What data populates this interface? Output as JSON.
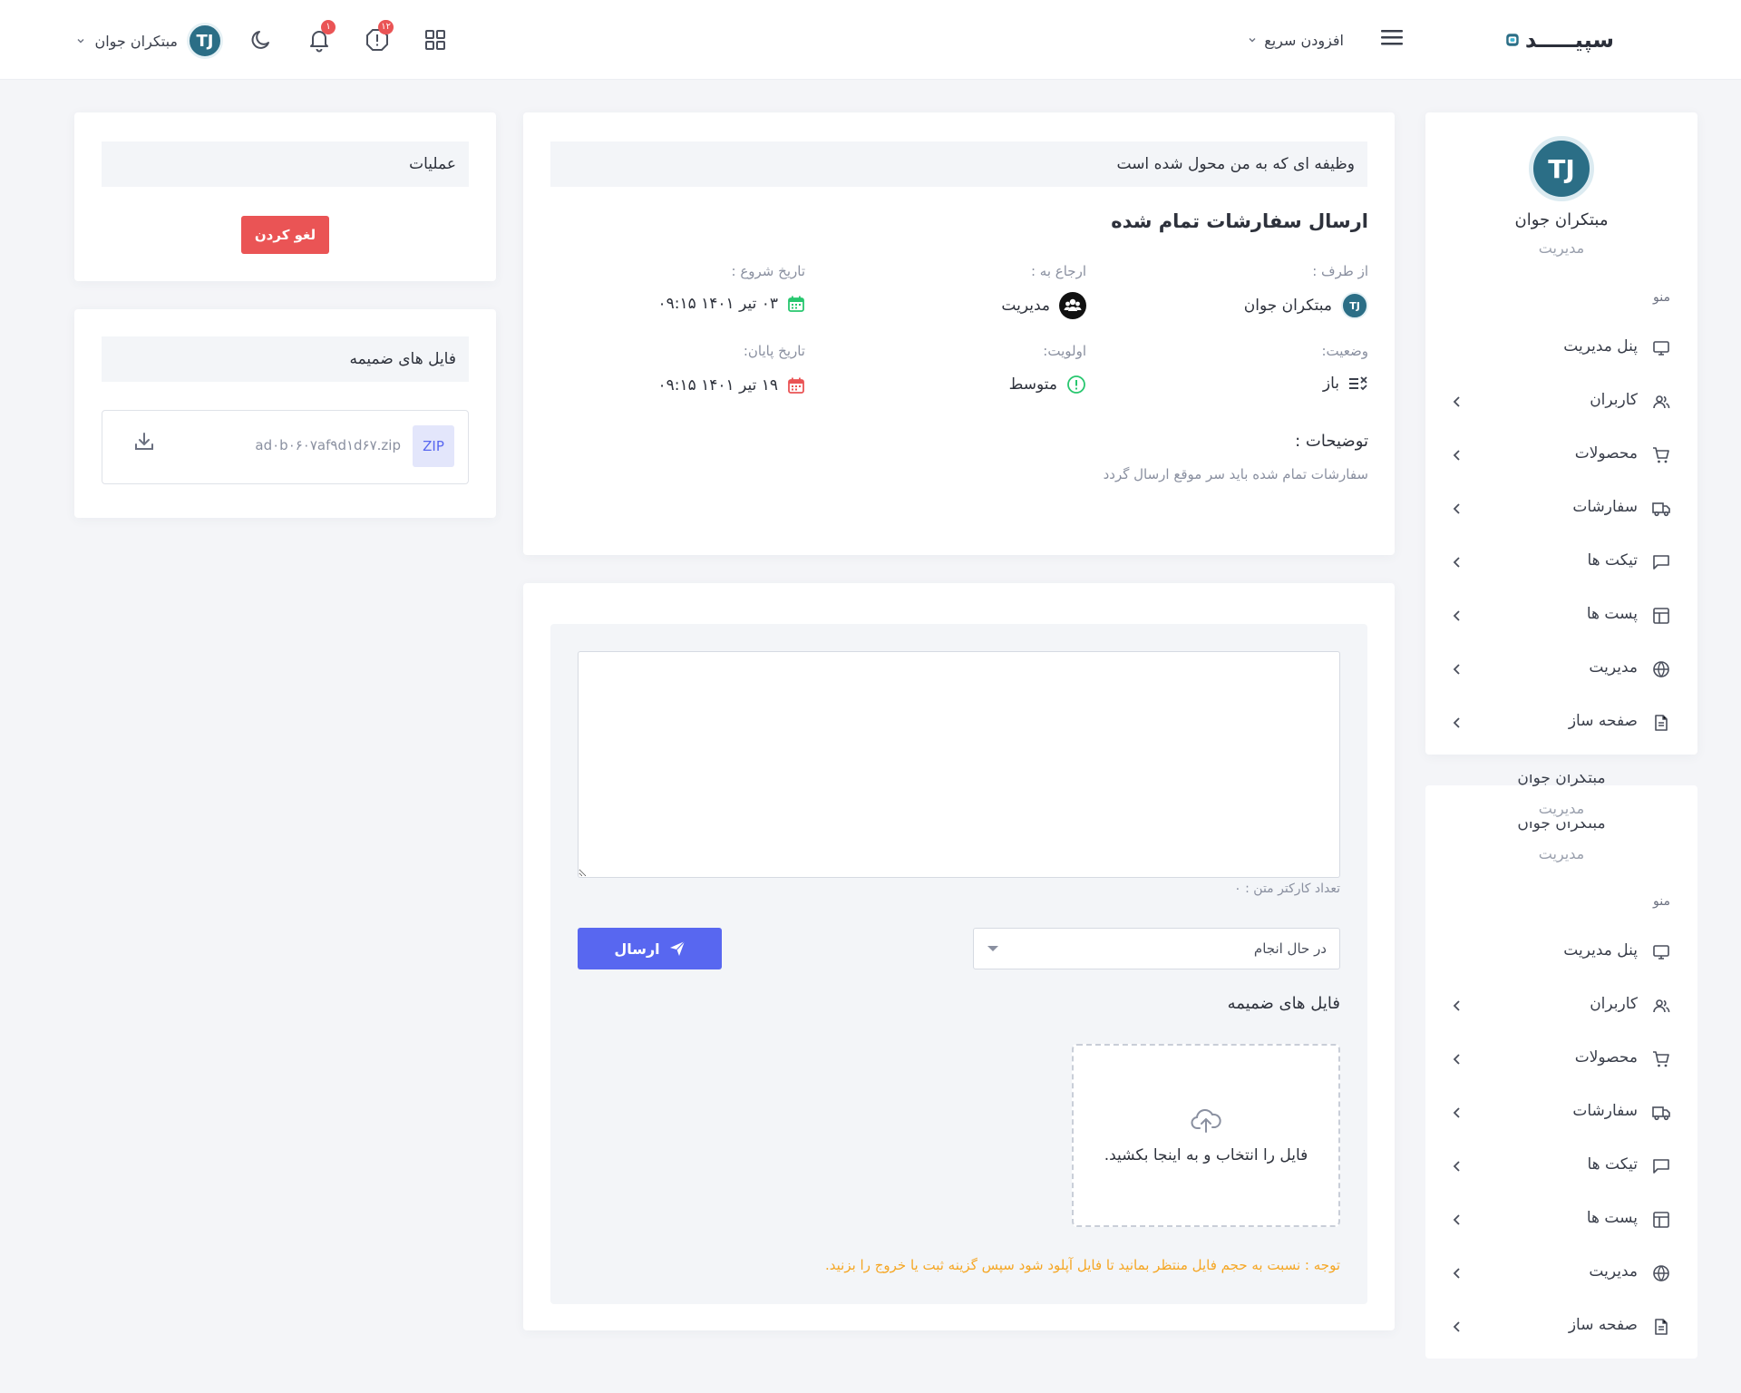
{
  "header": {
    "logo_text": "سپیـــــد",
    "quick_add": "افزودن سریع",
    "notif_badge_1": "۱۲",
    "notif_badge_2": "۱",
    "user_name": "مبتکران جوان",
    "avatar_text": "TJ"
  },
  "sidebar": {
    "profile_name": "مبتکران جوان",
    "profile_role": "مدیریت",
    "menu_caption": "منو",
    "items": [
      {
        "label": "پنل مدیریت",
        "icon": "monitor-icon"
      },
      {
        "label": "کاربران",
        "icon": "users-icon"
      },
      {
        "label": "محصولات",
        "icon": "cart-icon"
      },
      {
        "label": "سفارشات",
        "icon": "truck-icon"
      },
      {
        "label": "تیکت ها",
        "icon": "message-icon"
      },
      {
        "label": "پست ها",
        "icon": "layout-icon"
      },
      {
        "label": "مدیریت",
        "icon": "globe-icon"
      },
      {
        "label": "صفحه ساز",
        "icon": "file-icon"
      }
    ],
    "ghost_name": "مبتکران جوان",
    "ghost_role": "مدیریت"
  },
  "task": {
    "header": "وظیفه ای که به من محول شده است",
    "title": "ارسال سفارشات تمام شده",
    "from_label": "از طرف :",
    "from_value": "مبتکران جوان",
    "assigned_label": "ارجاع به :",
    "assigned_value": "مدیریت",
    "start_label": "تاریخ شروع :",
    "start_value": "۰۳ تیر ۱۴۰۱ ۰۹:۱۵",
    "status_label": "وضعیت:",
    "status_value": "باز",
    "priority_label": "اولویت:",
    "priority_value": "متوسط",
    "end_label": "تاریخ پایان:",
    "end_value": "۱۹ تیر ۱۴۰۱ ۰۹:۱۵",
    "desc_label": "توضیحات :",
    "desc_value": "سفارشات تمام شده باید سر موقع ارسال گردد"
  },
  "reply": {
    "textarea_value": "",
    "char_count": "تعداد کارکتر متن : ۰",
    "status_select": "در حال انجام",
    "send_label": "ارسال",
    "attach_title": "فایل های ضمیمه",
    "dropzone_text": "فایل را انتخاب و به اینجا بکشید.",
    "note": "توجه : نسبت به حجم فایل منتظر بمانید تا فایل آپلود شود سپس گزینه ثبت یا خروج را بزنید."
  },
  "operations": {
    "header": "عملیات",
    "cancel_label": "لغو کردن"
  },
  "attachments": {
    "header": "فایل های ضمیمه",
    "file_type": "ZIP",
    "file_name": "ad۰b۰۶۰۷af۹d۱d۶۷.zip"
  },
  "colors": {
    "accent": "#5867f0",
    "danger": "#ea5455",
    "warning": "#f5a623",
    "success": "#28c76f",
    "brand": "#2b6e86"
  }
}
